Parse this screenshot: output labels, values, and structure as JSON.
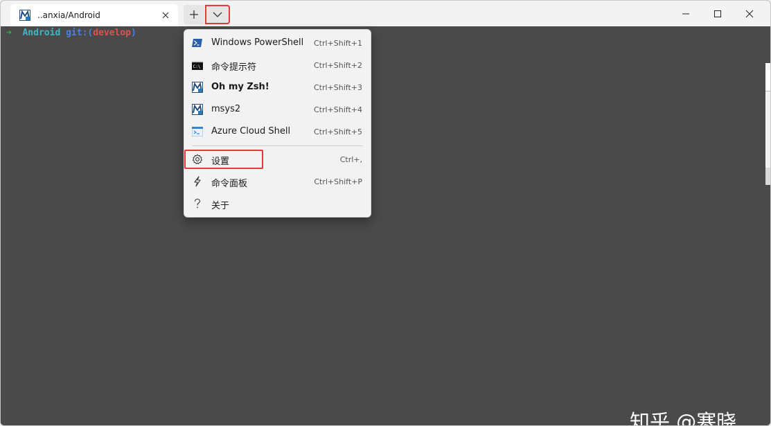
{
  "tab": {
    "title": "..anxia/Android",
    "icon": "msys-icon"
  },
  "titlebar": {
    "new_tab_icon": "plus-icon",
    "dropdown_icon": "chevron-down-icon",
    "minimize_icon": "minimize-icon",
    "maximize_icon": "maximize-icon",
    "close_icon": "close-icon"
  },
  "terminal": {
    "prompt_arrow": "➜",
    "prompt_dir": "Android",
    "prompt_git": "git:(",
    "prompt_branch": "develop",
    "prompt_close": ")"
  },
  "menu": {
    "items": [
      {
        "label": "Windows PowerShell",
        "shortcut": "Ctrl+Shift+1",
        "icon": "powershell-icon"
      },
      {
        "label": "命令提示符",
        "shortcut": "Ctrl+Shift+2",
        "icon": "cmd-icon"
      },
      {
        "label": "Oh my Zsh!",
        "shortcut": "Ctrl+Shift+3",
        "icon": "msys-icon"
      },
      {
        "label": "msys2",
        "shortcut": "Ctrl+Shift+4",
        "icon": "msys-icon"
      },
      {
        "label": "Azure Cloud Shell",
        "shortcut": "Ctrl+Shift+5",
        "icon": "azure-icon"
      },
      {
        "label": "设置",
        "shortcut": "Ctrl+,",
        "icon": "gear-icon"
      },
      {
        "label": "命令面板",
        "shortcut": "Ctrl+Shift+P",
        "icon": "lightning-icon"
      },
      {
        "label": "关于",
        "shortcut": "",
        "icon": "question-icon"
      }
    ]
  },
  "watermark": {
    "text": "知乎 @寒晓"
  },
  "colors": {
    "highlight": "#e03a3a",
    "terminal_bg": "#4a4a4a",
    "prompt_arrow": "#2fb347",
    "prompt_dir": "#3fb7c5",
    "prompt_git": "#4c7fe0",
    "prompt_branch": "#e05050"
  }
}
